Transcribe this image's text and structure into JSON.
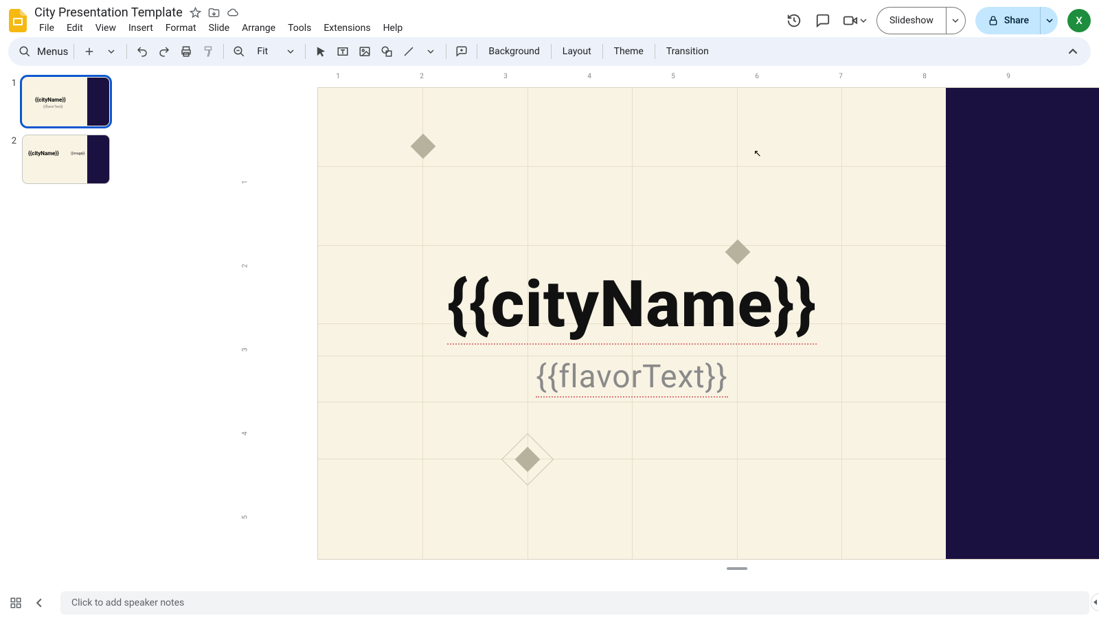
{
  "doc": {
    "title": "City Presentation Template"
  },
  "menu": {
    "file": "File",
    "edit": "Edit",
    "view": "View",
    "insert": "Insert",
    "format": "Format",
    "slide": "Slide",
    "arrange": "Arrange",
    "tools": "Tools",
    "extensions": "Extensions",
    "help": "Help"
  },
  "header": {
    "slideshow": "Slideshow",
    "share": "Share",
    "avatar": "X"
  },
  "toolbar": {
    "menus_label": "Menus",
    "zoom": "Fit",
    "background": "Background",
    "layout": "Layout",
    "theme": "Theme",
    "transition": "Transition"
  },
  "ruler": {
    "h": [
      "1",
      "2",
      "3",
      "4",
      "5",
      "6",
      "7",
      "8",
      "9"
    ],
    "v": [
      "1",
      "2",
      "3",
      "4",
      "5"
    ]
  },
  "filmstrip": {
    "slides": [
      {
        "num": "1",
        "title": "{{cityName}}",
        "sub": "{{flavorText}}"
      },
      {
        "num": "2",
        "title": "{{cityName}}",
        "img": "{{image}}"
      }
    ]
  },
  "slide": {
    "title": "{{cityName}}",
    "subtitle": "{{flavorText}}"
  },
  "notes": {
    "placeholder": "Click to add speaker notes"
  }
}
